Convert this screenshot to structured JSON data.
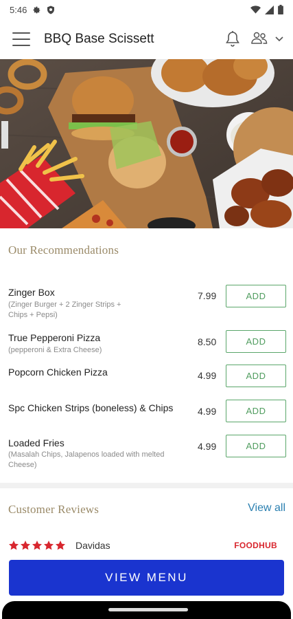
{
  "status_bar": {
    "time": "5:46"
  },
  "header": {
    "title": "BBQ Base Scissett"
  },
  "recommendations": {
    "title": "Our Recommendations",
    "items": [
      {
        "name": "Zinger Box",
        "description": "(Zinger Burger + 2 Zinger Strips + Chips + Pepsi)",
        "price": "7.99",
        "button": "ADD"
      },
      {
        "name": "True Pepperoni Pizza",
        "description": "(pepperoni & Extra Cheese)",
        "price": "8.50",
        "button": "ADD"
      },
      {
        "name": "Popcorn Chicken Pizza",
        "description": "",
        "price": "4.99",
        "button": "ADD"
      },
      {
        "name": "Spc Chicken Strips (boneless) & Chips",
        "description": "",
        "price": "4.99",
        "button": "ADD"
      },
      {
        "name": "Loaded Fries",
        "description": "(Masalah Chips, Jalapenos loaded with melted Cheese)",
        "price": "4.99",
        "button": "ADD"
      }
    ]
  },
  "reviews": {
    "title": "Customer Reviews",
    "view_all": "View all",
    "first": {
      "reviewer": "Davidas",
      "rating": 5,
      "source": "FOODHUB"
    }
  },
  "footer": {
    "view_menu": "VIEW MENU"
  },
  "colors": {
    "accent_title": "#9a8a68",
    "add_border": "#5aa66a",
    "link": "#2a7fb0",
    "primary_button": "#1a34cf",
    "star": "#d8262e"
  }
}
